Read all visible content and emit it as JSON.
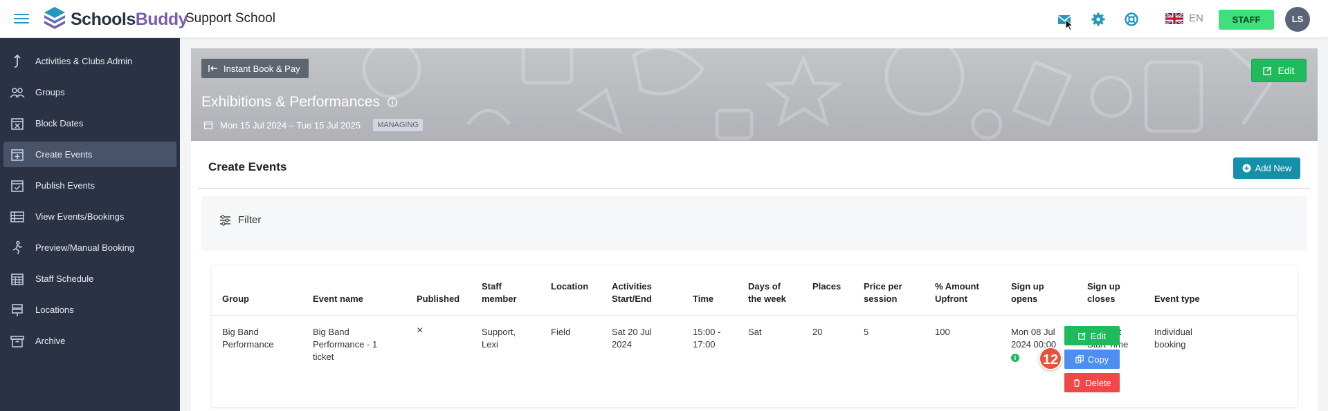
{
  "app": {
    "logo_part1": "Schools",
    "logo_part2": "Buddy",
    "school_name": "Support School"
  },
  "header": {
    "language_code": "EN",
    "staff_label": "STAFF",
    "avatar_initials": "LS"
  },
  "sidebar": {
    "items": [
      {
        "label": "Activities & Clubs Admin",
        "icon": "up-arrow-icon"
      },
      {
        "label": "Groups",
        "icon": "people-icon"
      },
      {
        "label": "Block Dates",
        "icon": "calendar-x-icon"
      },
      {
        "label": "Create Events",
        "icon": "calendar-plus-icon"
      },
      {
        "label": "Publish Events",
        "icon": "calendar-check-icon"
      },
      {
        "label": "View Events/Bookings",
        "icon": "table-icon"
      },
      {
        "label": "Preview/Manual Booking",
        "icon": "person-running-icon"
      },
      {
        "label": "Staff Schedule",
        "icon": "calendar-grid-icon"
      },
      {
        "label": "Locations",
        "icon": "signpost-icon"
      },
      {
        "label": "Archive",
        "icon": "archive-box-icon"
      }
    ]
  },
  "banner": {
    "back_label": "Instant Book & Pay",
    "edit_label": "Edit",
    "title": "Exhibitions & Performances",
    "date_range": "Mon 15 Jul 2024 – Tue 15 Jul 2025",
    "status_badge": "MANAGING"
  },
  "main": {
    "title": "Create Events",
    "add_new_label": "Add New",
    "filter_label": "Filter"
  },
  "table": {
    "headers": {
      "group": "Group",
      "event_name": "Event name",
      "published": "Published",
      "staff_line1": "Staff",
      "staff_line2": "member",
      "location": "Location",
      "activities_line1": "Activities",
      "activities_line2": "Start/End",
      "time": "Time",
      "days_line1": "Days of",
      "days_line2": "the week",
      "places": "Places",
      "price_line1": "Price per",
      "price_line2": "session",
      "amount_line1": "% Amount",
      "amount_line2": "Upfront",
      "opens_line1": "Sign up",
      "opens_line2": "opens",
      "closes_line1": "Sign up",
      "closes_line2": "closes",
      "event_type": "Event type"
    },
    "row": {
      "group_l1": "Big Band",
      "group_l2": "Performance",
      "event_l1": "Big Band",
      "event_l2": "Performance - 1",
      "event_l3": "ticket",
      "published": "×",
      "staff_l1": "Support,",
      "staff_l2": "Lexi",
      "location": "Field",
      "start_l1": "Sat 20 Jul",
      "start_l2": "2024",
      "time_l1": "15:00 -",
      "time_l2": "17:00",
      "days": "Sat",
      "places": "20",
      "price": "5",
      "upfront": "100",
      "opens_l1": "Mon 08 Jul",
      "opens_l2": "2024 00:00",
      "closes_l1": "At Event",
      "closes_l2": "Start Time",
      "type_l1": "Individual",
      "type_l2": "booking",
      "edit_label": "Edit",
      "copy_label": "Copy",
      "delete_label": "Delete"
    },
    "step_badge": "12"
  },
  "colors": {
    "sidebar_bg": "#2b3245",
    "sidebar_active": "#485268",
    "accent_teal": "#1491a8",
    "success_green": "#1fba5b",
    "copy_blue": "#4d8ef0",
    "danger_red": "#f04848",
    "staff_green": "#3ee07c",
    "icon_blue": "#2596be"
  }
}
